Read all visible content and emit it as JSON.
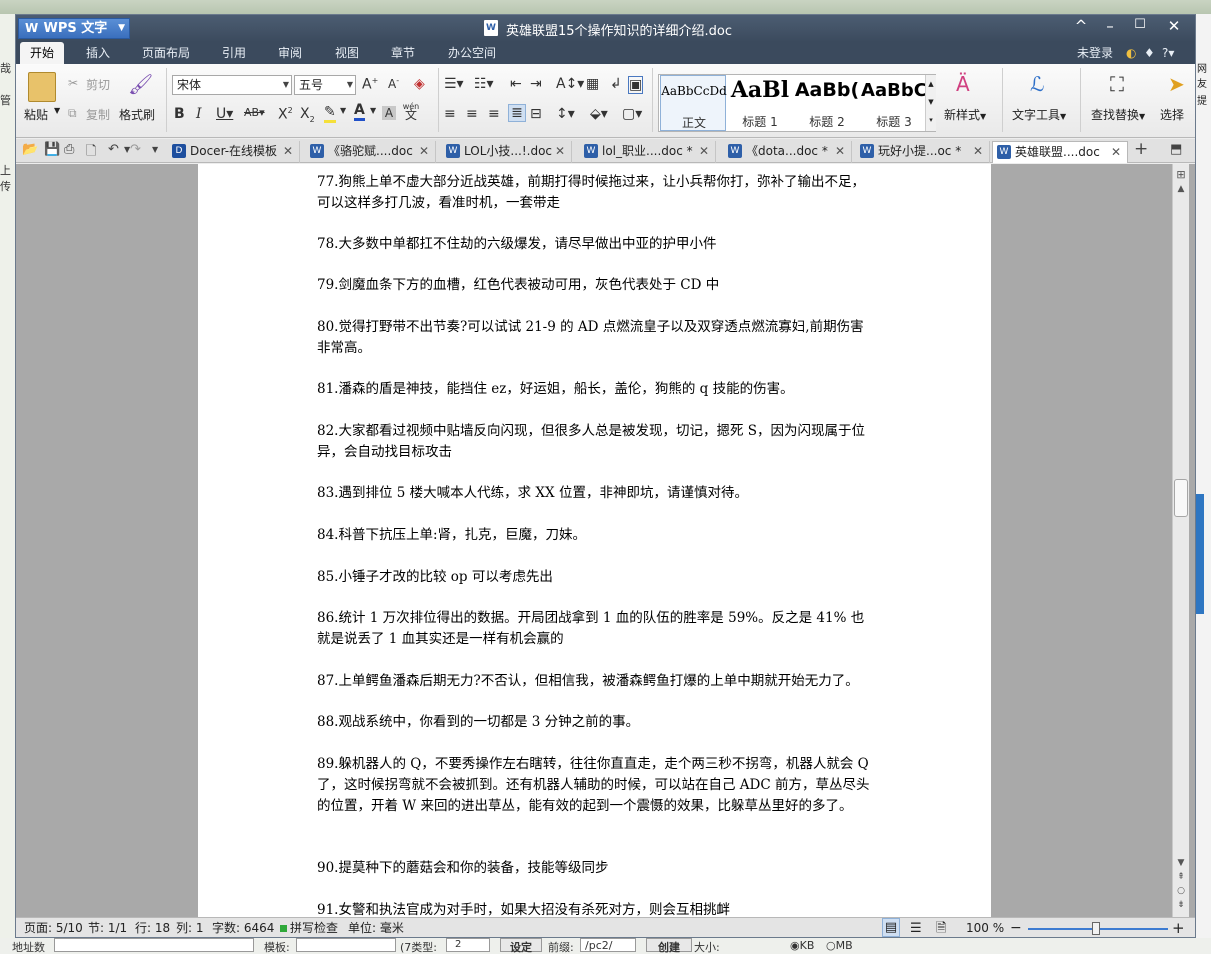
{
  "background": {
    "left_labels": [
      "哉",
      "管",
      "上传"
    ],
    "right_labels": [
      "网友",
      "提"
    ],
    "bottom": {
      "label1": "地址数",
      "label2": "模板:",
      "label3": "(7类型:",
      "select_val": "2",
      "btn1": "设定",
      "label4": "前缀:",
      "input_val": "/pc2/",
      "btn2": "创建",
      "label5": "大小:",
      "radio1": "KB",
      "radio2": "MB"
    }
  },
  "titlebar": {
    "app_button": "WPS 文字",
    "doc_title": "英雄联盟15个操作知识的详细介绍.doc",
    "minimize": "–",
    "maximize": "☐",
    "close": "✕",
    "collapse": "^"
  },
  "menubar": {
    "tabs": [
      "开始",
      "插入",
      "页面布局",
      "引用",
      "审阅",
      "视图",
      "章节",
      "办公空间"
    ],
    "login": "未登录"
  },
  "ribbon": {
    "paste": "粘贴",
    "cut": "剪切",
    "copy": "复制",
    "format_painter": "格式刷",
    "font_name": "宋体",
    "font_size": "五号",
    "pinyin_label": "wén",
    "styles": [
      {
        "preview": "AaBbCcDd",
        "label": "正文"
      },
      {
        "preview": "AaBl",
        "label": "标题 1"
      },
      {
        "preview": "AaBb(",
        "label": "标题 2"
      },
      {
        "preview": "AaBbC",
        "label": "标题 3"
      }
    ],
    "new_style": "新样式",
    "text_tools": "文字工具",
    "find_replace": "查找替换",
    "select": "选择"
  },
  "doc_tabs": [
    {
      "label": "Docer-在线模板",
      "icon": "docer-icon"
    },
    {
      "label": "《骆驼赋....doc",
      "icon": "w-doc-icon"
    },
    {
      "label": "LOL小技...!.doc",
      "icon": "w-doc-icon"
    },
    {
      "label": "lol_职业....doc *",
      "icon": "w-doc-icon"
    },
    {
      "label": "《dota...doc *",
      "icon": "w-doc-icon"
    },
    {
      "label": "玩好小提...oc *",
      "icon": "w-doc-icon"
    },
    {
      "label": "英雄联盟....doc",
      "icon": "w-doc-icon"
    }
  ],
  "document": {
    "paragraphs": [
      "77.狗熊上单不虚大部分近战英雄，前期打得时候拖过来，让小兵帮你打，弥补了输出不足，可以这样多打几波，看准时机，一套带走",
      "78.大多数中单都扛不住劫的六级爆发，请尽早做出中亚的护甲小件",
      "79.剑魔血条下方的血槽，红色代表被动可用，灰色代表处于 CD 中",
      "80.觉得打野带不出节奏?可以试试 21-9 的 AD 点燃流皇子以及双穿透点燃流寡妇,前期伤害非常高。",
      "81.潘森的盾是神技，能挡住 ez，好运姐，船长，盖伦，狗熊的 q 技能的伤害。",
      "82.大家都看过视频中贴墙反向闪现，但很多人总是被发现，切记，摁死 S，因为闪现属于位异，会自动找目标攻击",
      "83.遇到排位 5 楼大喊本人代练，求 XX 位置，非神即坑，请谨慎对待。",
      "84.科普下抗压上单:肾，扎克，巨魔，刀妹。",
      "85.小锤子才改的比较 op 可以考虑先出",
      "86.统计 1 万次排位得出的数据。开局团战拿到 1 血的队伍的胜率是 59%。反之是 41% 也就是说丢了 1 血其实还是一样有机会赢的",
      "87.上单鳄鱼潘森后期无力?不否认，但相信我，被潘森鳄鱼打爆的上单中期就开始无力了。",
      "88.观战系统中，你看到的一切都是 3 分钟之前的事。",
      "89.躲机器人的 Q，不要秀操作左右瞎转，往往你直直走，走个两三秒不拐弯，机器人就会 Q 了，这时候拐弯就不会被抓到。还有机器人辅助的时候，可以站在自己 ADC 前方，草丛尽头的位置，开着 W 来回的进出草丛，能有效的起到一个震慑的效果，比躲草丛里好的多了。",
      "90.提莫种下的蘑菇会和你的装备，技能等级同步",
      "91.女警和执法官成为对手时，如果大招没有杀死对方，则会互相挑衅"
    ]
  },
  "statusbar": {
    "page": "页面: 5/10",
    "section": "节: 1/1",
    "line": "行: 18",
    "col": "列: 1",
    "words": "字数: 6464",
    "spellcheck": "拼写检查",
    "unit": "单位: 毫米",
    "zoom": "100 %",
    "zoom_level": 1.0
  },
  "colors": {
    "titlebar": "#3b4a5d",
    "accent": "#3d7bd1",
    "doc_background": "#a9a9a9"
  }
}
